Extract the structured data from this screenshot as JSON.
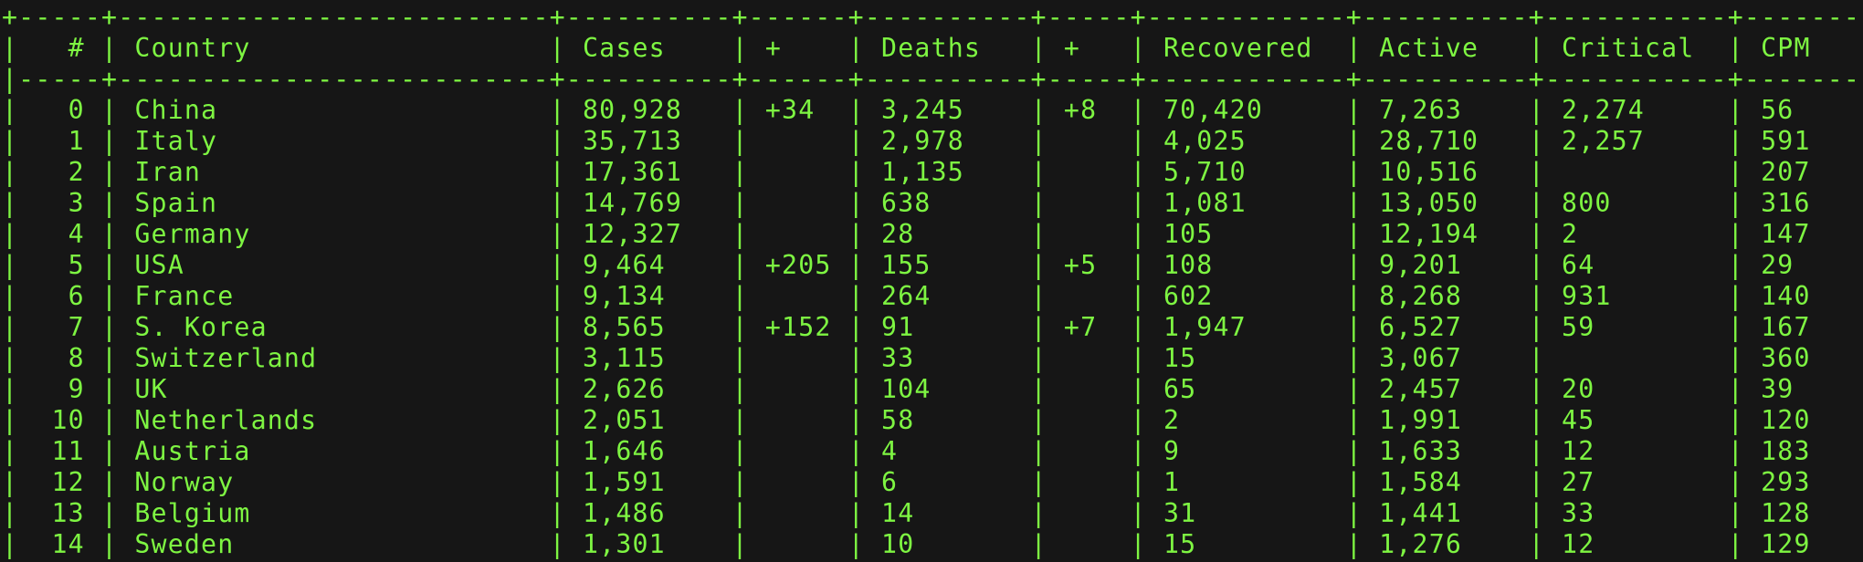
{
  "theme": {
    "background": "#161616",
    "foreground": "#7ef542"
  },
  "table": {
    "columns": [
      {
        "key": "rank",
        "label": "#",
        "width": 5,
        "align": "right"
      },
      {
        "key": "country",
        "label": "Country",
        "width": 26,
        "align": "left"
      },
      {
        "key": "cases",
        "label": "Cases",
        "width": 10,
        "align": "left"
      },
      {
        "key": "new_cases",
        "label": "+",
        "width": 6,
        "align": "left"
      },
      {
        "key": "deaths",
        "label": "Deaths",
        "width": 10,
        "align": "left"
      },
      {
        "key": "new_deaths",
        "label": "+",
        "width": 5,
        "align": "left"
      },
      {
        "key": "recovered",
        "label": "Recovered",
        "width": 12,
        "align": "left"
      },
      {
        "key": "active",
        "label": "Active",
        "width": 10,
        "align": "left"
      },
      {
        "key": "critical",
        "label": "Critical",
        "width": 11,
        "align": "left"
      },
      {
        "key": "cpm",
        "label": "CPM",
        "width": 7,
        "align": "left"
      }
    ],
    "rows": [
      {
        "rank": "0",
        "country": "China",
        "cases": "80,928",
        "new_cases": "+34",
        "deaths": "3,245",
        "new_deaths": "+8",
        "recovered": "70,420",
        "active": "7,263",
        "critical": "2,274",
        "cpm": "56"
      },
      {
        "rank": "1",
        "country": "Italy",
        "cases": "35,713",
        "new_cases": "",
        "deaths": "2,978",
        "new_deaths": "",
        "recovered": "4,025",
        "active": "28,710",
        "critical": "2,257",
        "cpm": "591"
      },
      {
        "rank": "2",
        "country": "Iran",
        "cases": "17,361",
        "new_cases": "",
        "deaths": "1,135",
        "new_deaths": "",
        "recovered": "5,710",
        "active": "10,516",
        "critical": "",
        "cpm": "207"
      },
      {
        "rank": "3",
        "country": "Spain",
        "cases": "14,769",
        "new_cases": "",
        "deaths": "638",
        "new_deaths": "",
        "recovered": "1,081",
        "active": "13,050",
        "critical": "800",
        "cpm": "316"
      },
      {
        "rank": "4",
        "country": "Germany",
        "cases": "12,327",
        "new_cases": "",
        "deaths": "28",
        "new_deaths": "",
        "recovered": "105",
        "active": "12,194",
        "critical": "2",
        "cpm": "147"
      },
      {
        "rank": "5",
        "country": "USA",
        "cases": "9,464",
        "new_cases": "+205",
        "deaths": "155",
        "new_deaths": "+5",
        "recovered": "108",
        "active": "9,201",
        "critical": "64",
        "cpm": "29"
      },
      {
        "rank": "6",
        "country": "France",
        "cases": "9,134",
        "new_cases": "",
        "deaths": "264",
        "new_deaths": "",
        "recovered": "602",
        "active": "8,268",
        "critical": "931",
        "cpm": "140"
      },
      {
        "rank": "7",
        "country": "S. Korea",
        "cases": "8,565",
        "new_cases": "+152",
        "deaths": "91",
        "new_deaths": "+7",
        "recovered": "1,947",
        "active": "6,527",
        "critical": "59",
        "cpm": "167"
      },
      {
        "rank": "8",
        "country": "Switzerland",
        "cases": "3,115",
        "new_cases": "",
        "deaths": "33",
        "new_deaths": "",
        "recovered": "15",
        "active": "3,067",
        "critical": "",
        "cpm": "360"
      },
      {
        "rank": "9",
        "country": "UK",
        "cases": "2,626",
        "new_cases": "",
        "deaths": "104",
        "new_deaths": "",
        "recovered": "65",
        "active": "2,457",
        "critical": "20",
        "cpm": "39"
      },
      {
        "rank": "10",
        "country": "Netherlands",
        "cases": "2,051",
        "new_cases": "",
        "deaths": "58",
        "new_deaths": "",
        "recovered": "2",
        "active": "1,991",
        "critical": "45",
        "cpm": "120"
      },
      {
        "rank": "11",
        "country": "Austria",
        "cases": "1,646",
        "new_cases": "",
        "deaths": "4",
        "new_deaths": "",
        "recovered": "9",
        "active": "1,633",
        "critical": "12",
        "cpm": "183"
      },
      {
        "rank": "12",
        "country": "Norway",
        "cases": "1,591",
        "new_cases": "",
        "deaths": "6",
        "new_deaths": "",
        "recovered": "1",
        "active": "1,584",
        "critical": "27",
        "cpm": "293"
      },
      {
        "rank": "13",
        "country": "Belgium",
        "cases": "1,486",
        "new_cases": "",
        "deaths": "14",
        "new_deaths": "",
        "recovered": "31",
        "active": "1,441",
        "critical": "33",
        "cpm": "128"
      },
      {
        "rank": "14",
        "country": "Sweden",
        "cases": "1,301",
        "new_cases": "",
        "deaths": "10",
        "new_deaths": "",
        "recovered": "15",
        "active": "1,276",
        "critical": "12",
        "cpm": "129"
      }
    ]
  }
}
